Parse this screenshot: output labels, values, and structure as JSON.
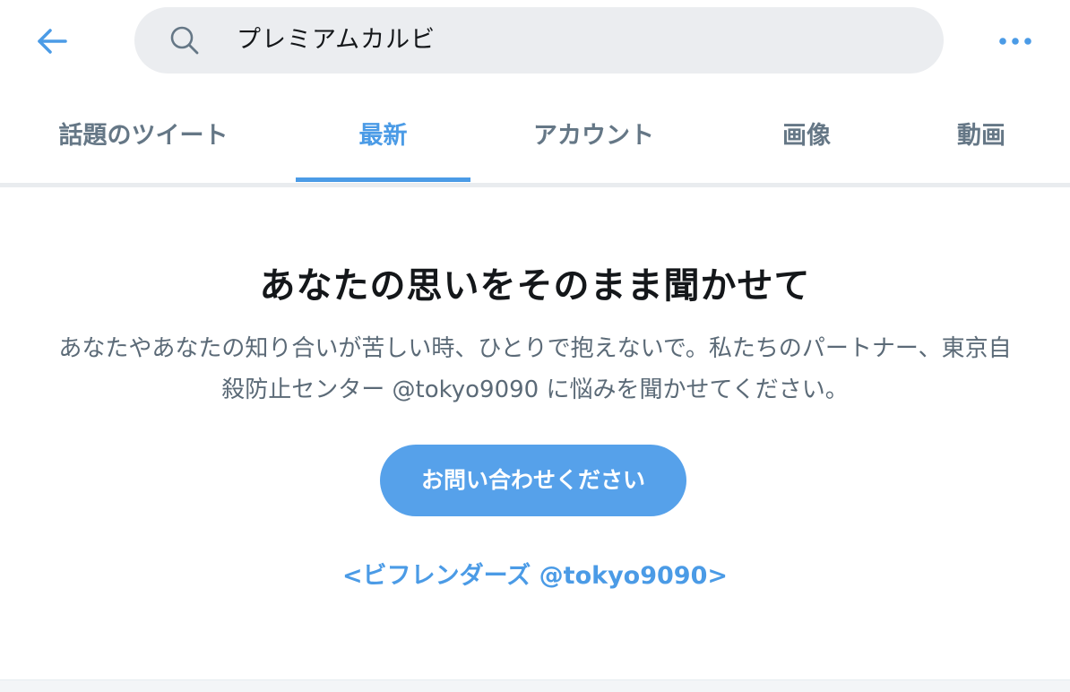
{
  "search": {
    "query": "プレミアムカルビ"
  },
  "tabs": [
    {
      "label": "話題のツイート",
      "active": false
    },
    {
      "label": "最新",
      "active": true
    },
    {
      "label": "アカウント",
      "active": false
    },
    {
      "label": "画像",
      "active": false
    },
    {
      "label": "動画",
      "active": false
    }
  ],
  "notice": {
    "title": "あなたの思いをそのまま聞かせて",
    "body_line1": "あなたやあなたの知り合いが苦しい時、ひとりで抱えないで。私たちのパートナー、東京自",
    "body_line2": "殺防止センター @tokyo9090 に悩みを聞かせてください。",
    "button_label": "お問い合わせください",
    "partner_link": "<ビフレンダーズ @tokyo9090>"
  },
  "colors": {
    "accent": "#4b9be6",
    "button": "#56a1ea",
    "muted_text": "#657786",
    "search_bg": "#ebedf0"
  },
  "icons": [
    "back-arrow-icon",
    "search-icon",
    "more-options-icon"
  ]
}
